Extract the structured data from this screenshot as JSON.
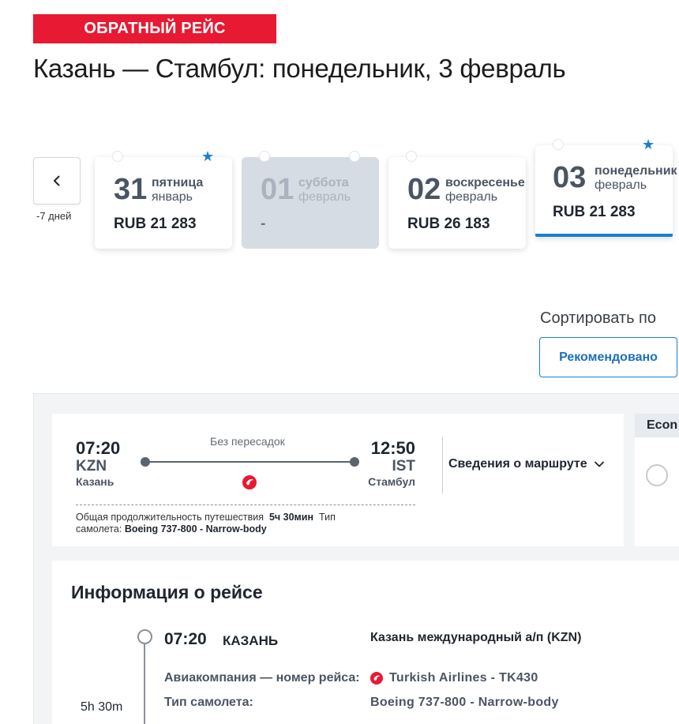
{
  "header": {
    "tag": "ОБРАТНЫЙ РЕЙС",
    "title": "Казань — Стамбул: понедельник, 3 февраль"
  },
  "date_nav": {
    "prev_label": "-7 дней",
    "days": [
      {
        "num": "31",
        "weekday": "пятница",
        "month": "январь",
        "price": "RUB 21 283",
        "starred": true
      },
      {
        "num": "01",
        "weekday": "суббота",
        "month": "февраль",
        "price": "-",
        "disabled": true
      },
      {
        "num": "02",
        "weekday": "воскресенье",
        "month": "февраль",
        "price": "RUB 26 183"
      },
      {
        "num": "03",
        "weekday": "понедельник",
        "month": "февраль",
        "price": "RUB 21 283",
        "starred": true,
        "selected": true
      }
    ]
  },
  "sort": {
    "label": "Сортировать по",
    "value": "Рекомендовано"
  },
  "flight": {
    "dep_time": "07:20",
    "dep_code": "KZN",
    "dep_city": "Казань",
    "arr_time": "12:50",
    "arr_code": "IST",
    "arr_city": "Стамбул",
    "stops": "Без пересадок",
    "duration_label": "Общая продолжительность путешествия",
    "duration": "5ч 30мин",
    "aircraft_label": "Тип самолета:",
    "aircraft": "Boeing 737-800 - Narrow-body",
    "details_link": "Сведения о маршруте",
    "fare_header": "Econ"
  },
  "flight_info": {
    "title": "Информация о рейсе",
    "segment_time": "07:20",
    "segment_city": "КАЗАНЬ",
    "airport": "Казань международный а/п (KZN)",
    "airline_label": "Авиакомпания — номер рейса:",
    "airline_value": "Turkish Airlines - TK430",
    "aircraft_label": "Тип самолета:",
    "aircraft_value": "Boeing 737-800 - Narrow-body",
    "segment_duration": "5h 30m"
  },
  "colors": {
    "brand_red": "#e81932",
    "accent_blue": "#1a7fd4"
  },
  "icons": {
    "prev": "chevron-left-icon",
    "star": "star-icon",
    "airline": "turkish-airlines-logo-icon",
    "expand": "chevron-down-icon"
  }
}
